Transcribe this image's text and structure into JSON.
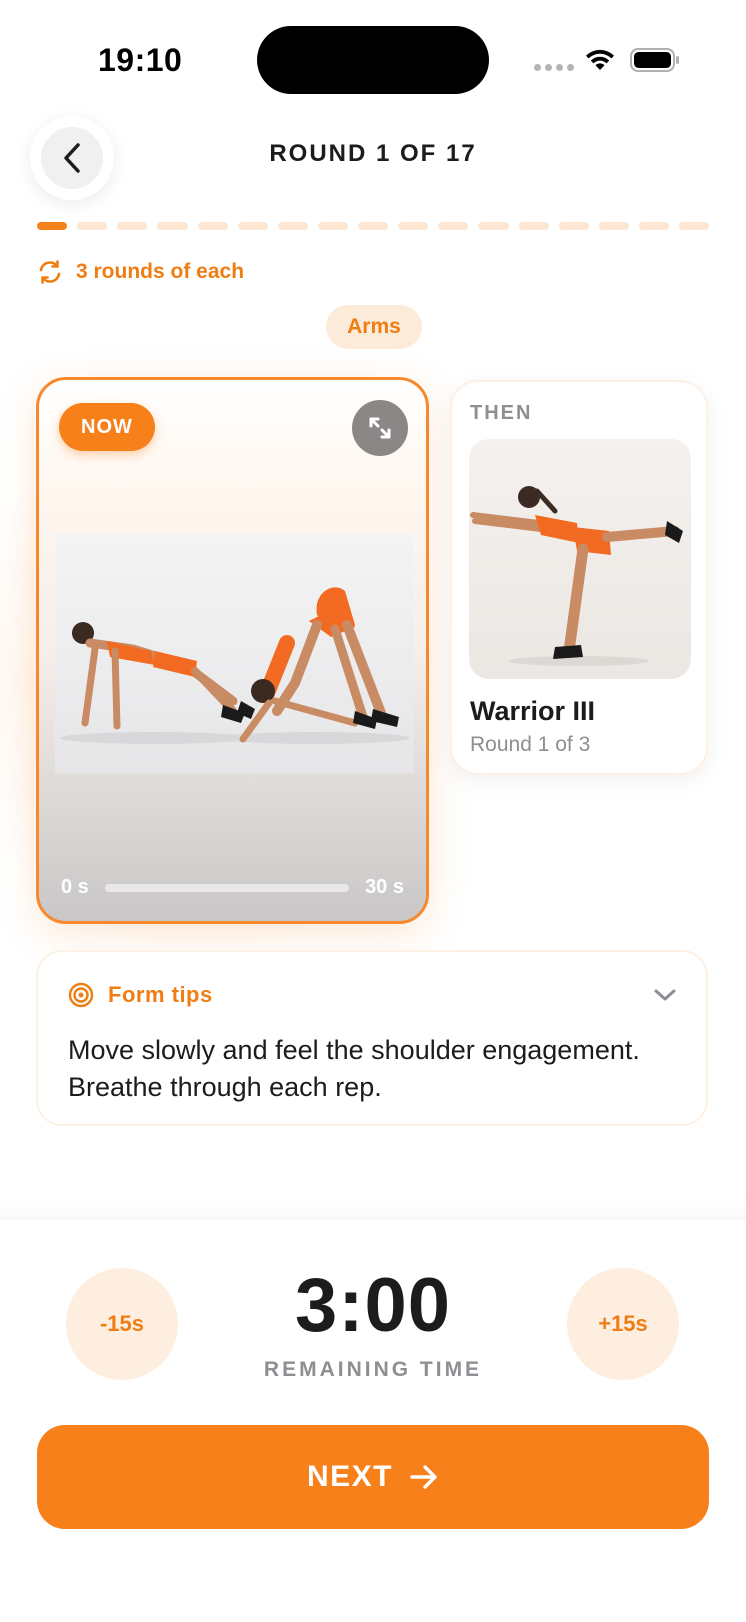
{
  "status_bar": {
    "time": "19:10"
  },
  "header": {
    "title": "ROUND 1 OF 17",
    "back_icon": "chevron-left-icon"
  },
  "progress": {
    "total_segments": 17,
    "current_segment": 1
  },
  "rounds_note": {
    "text": "3 rounds of each",
    "icon": "repeat-icon"
  },
  "category": "Arms",
  "now_card": {
    "badge": "NOW",
    "expand_icon": "expand-icon",
    "timeline_start": "0 s",
    "timeline_end": "30 s",
    "timeline_progress": 0.0
  },
  "then_card": {
    "label": "THEN",
    "title": "Warrior III",
    "subtitle": "Round 1 of 3"
  },
  "form_tips": {
    "title": "Form tips",
    "icon": "target-icon",
    "chevron": "chevron-down-icon",
    "body": "Move slowly and feel the shoulder engagement. Breathe through each rep."
  },
  "timer": {
    "value": "3:00",
    "label": "REMAINING TIME",
    "minus_label": "-15s",
    "plus_label": "+15s"
  },
  "next_button": {
    "label": "NEXT",
    "icon": "arrow-right-icon"
  },
  "colors": {
    "accent": "#f7801a",
    "accent_text": "#f07d14",
    "accent_soft": "#fdeedf",
    "muted_text": "#8e8e93"
  }
}
